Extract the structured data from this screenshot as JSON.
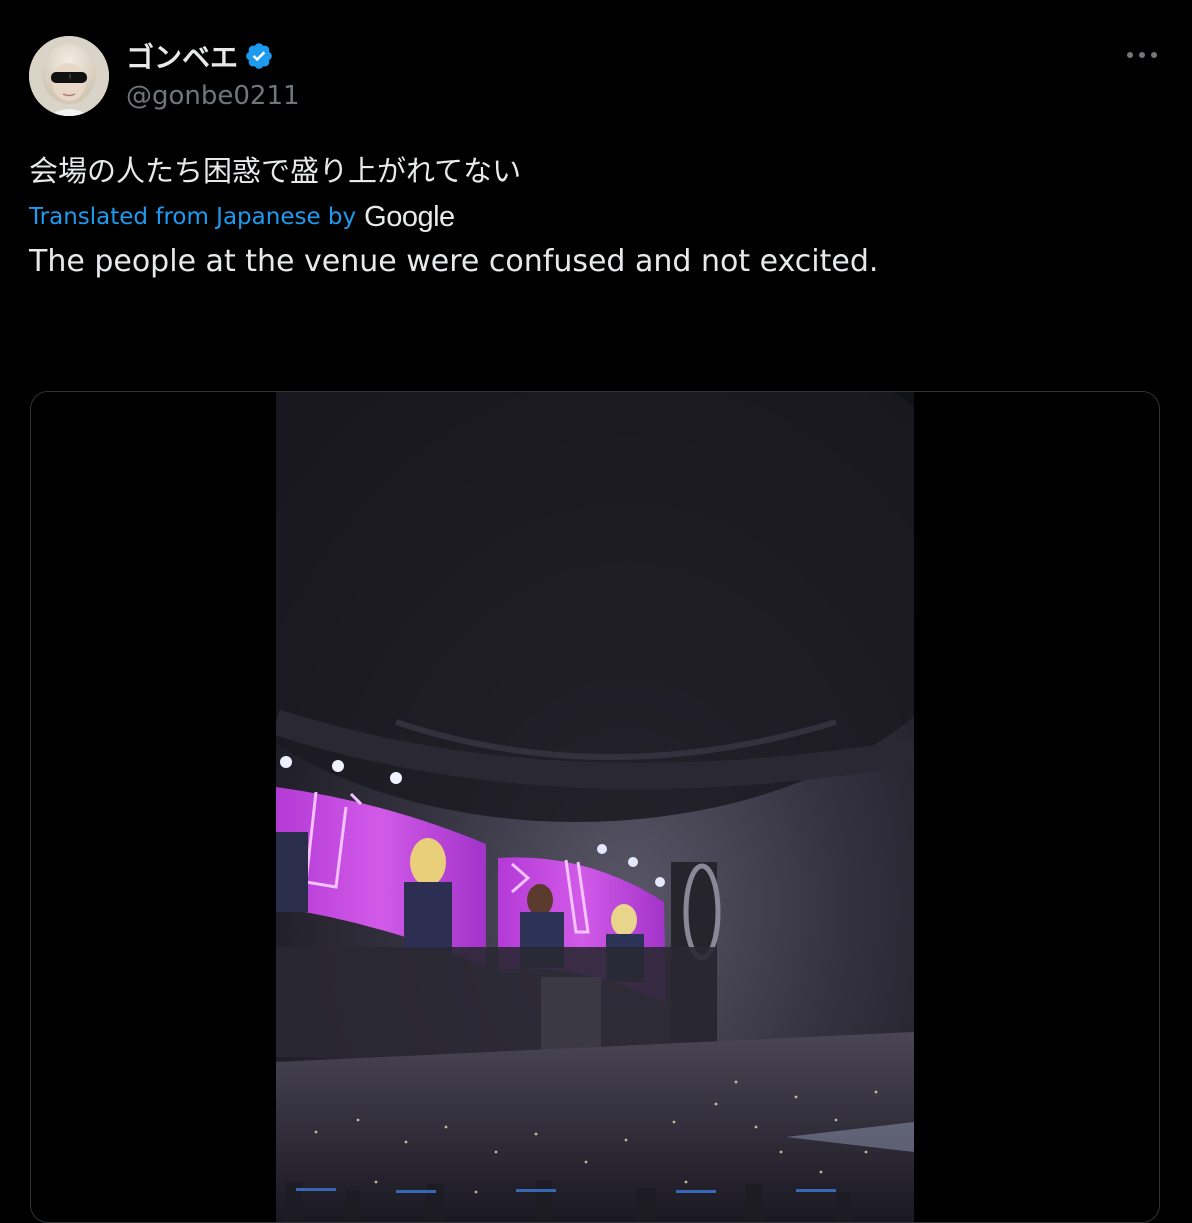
{
  "author": {
    "display_name": "ゴンベエ",
    "handle": "@gonbe0211",
    "verified": true,
    "verified_color": "#1d9bf0"
  },
  "tweet": {
    "text_original": "会場の人たち困惑で盛り上がれてない",
    "translated_label": "Translated from Japanese by",
    "translation_provider": "Google",
    "text_translated": "The people at the venue were confused and not excited."
  },
  "icons": {
    "more": "more-horizontal-icon",
    "verified": "verified-badge-icon"
  },
  "colors": {
    "background": "#000000",
    "text_primary": "#e7e9ea",
    "text_secondary": "#71767b",
    "link": "#1d9bf0"
  }
}
